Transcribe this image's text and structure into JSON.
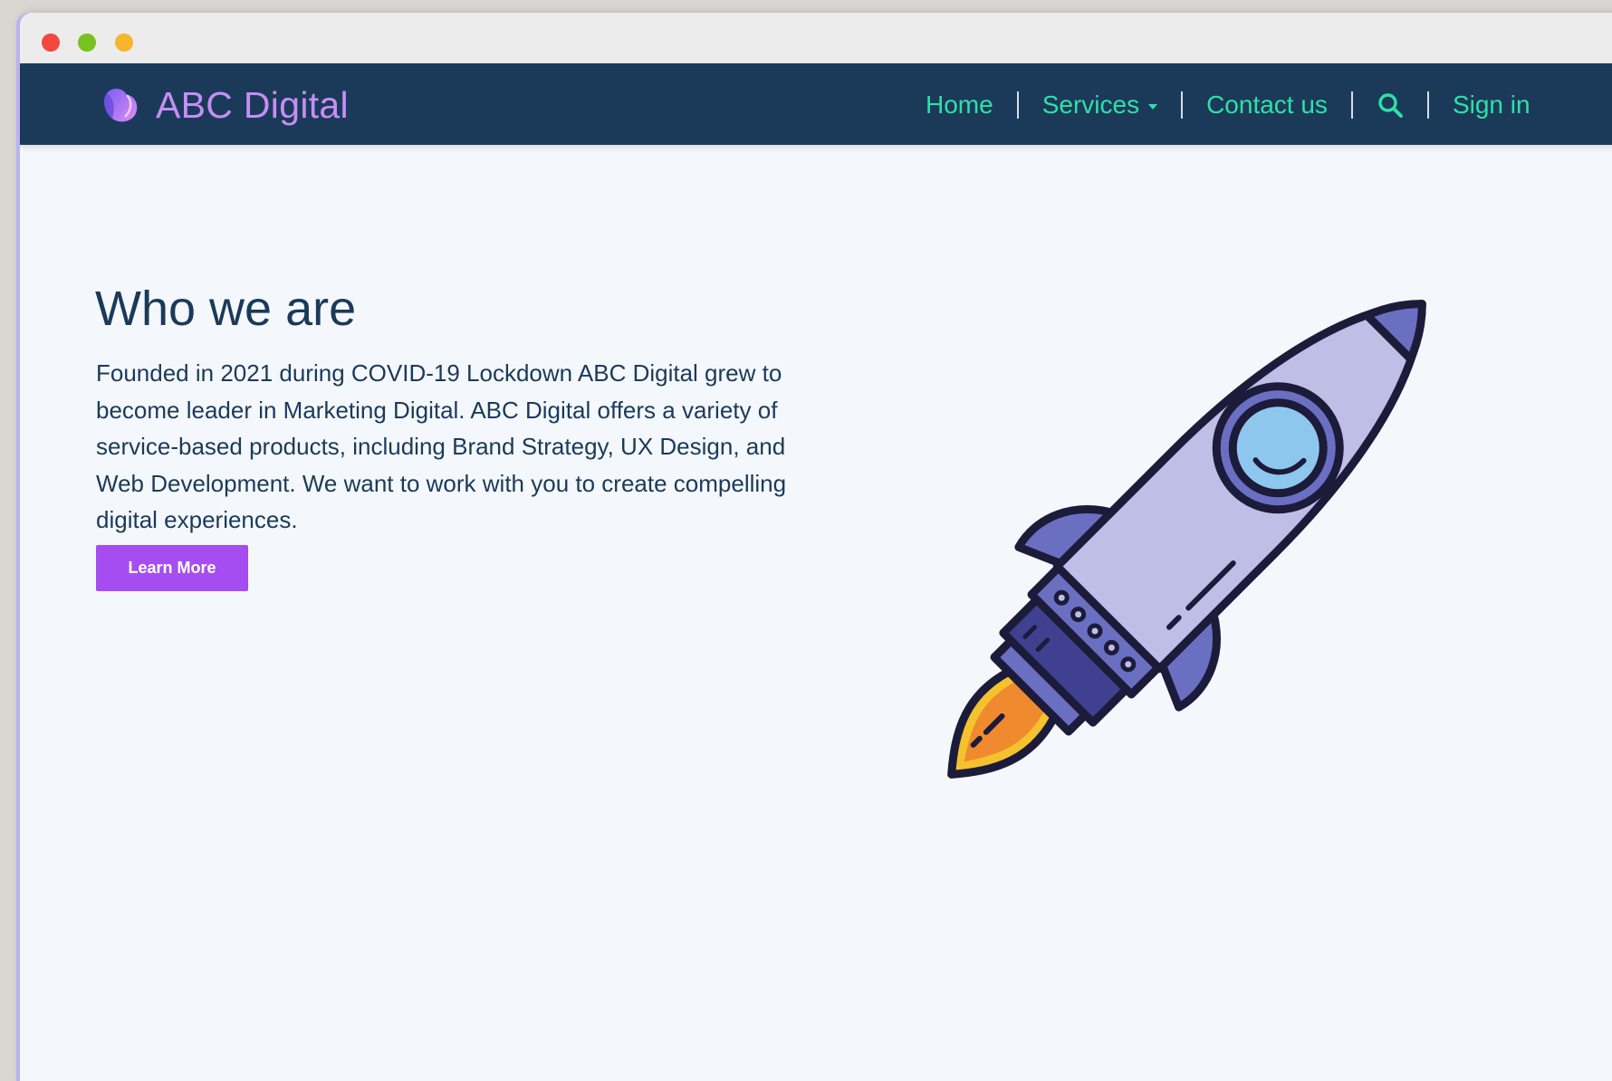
{
  "window": {
    "controls": [
      "close",
      "minimize",
      "maximize"
    ]
  },
  "navbar": {
    "brand_name": "ABC Digital",
    "links": {
      "home": "Home",
      "services": "Services",
      "contact": "Contact us",
      "signin": "Sign in"
    },
    "icons": {
      "logo": "brand-logo-icon",
      "services_dropdown": "caret-down-icon",
      "search": "search-icon"
    }
  },
  "hero": {
    "title": "Who we are",
    "description": "Founded in 2021 during COVID-19 Lockdown ABC Digital grew to become leader in Marketing Digital. ABC Digital offers a variety of service-based products, including Brand Strategy, UX Design, and Web Development. We want to work with you to create compelling digital experiences.",
    "button_label": "Learn More",
    "illustration": "rocket-illustration"
  },
  "colors": {
    "navbar_bg": "#1b3a59",
    "brand": "#c58ef5",
    "nav_link": "#2fe0a7",
    "text": "#1b3a59",
    "button": "#a54df0",
    "page_bg": "#f4f8fc"
  }
}
